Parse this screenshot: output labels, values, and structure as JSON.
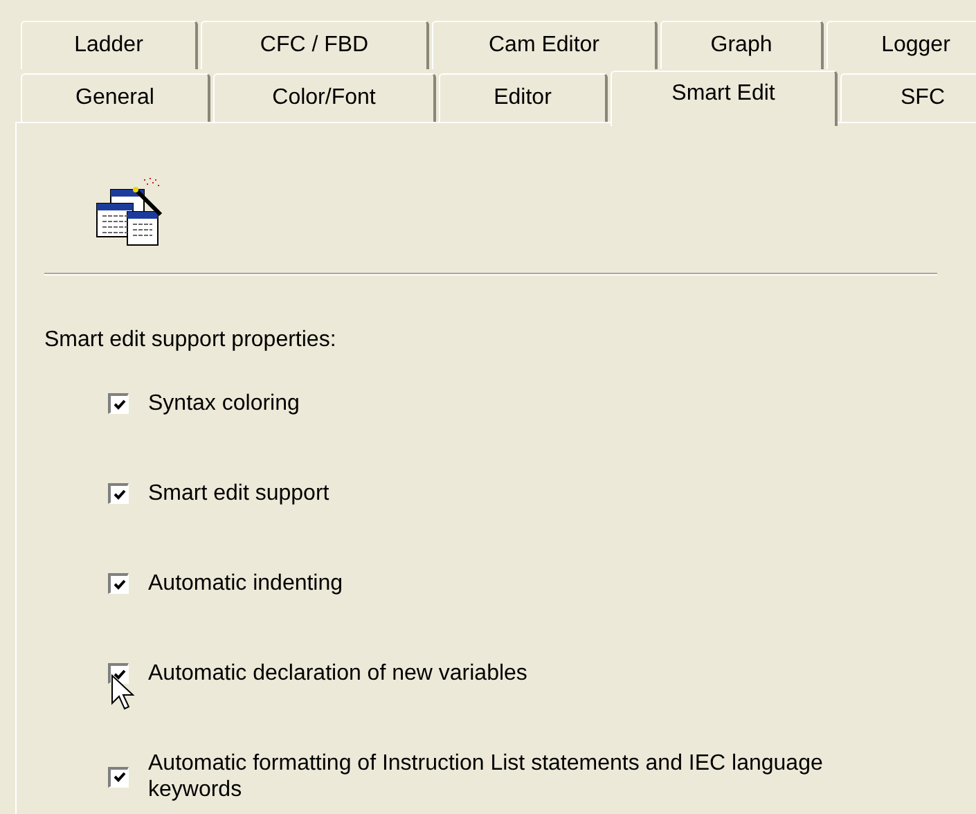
{
  "tab_rows": [
    {
      "tabs": [
        {
          "label": "Ladder",
          "selected": false
        },
        {
          "label": "CFC / FBD",
          "selected": false
        },
        {
          "label": "Cam Editor",
          "selected": false
        },
        {
          "label": "Graph",
          "selected": false
        },
        {
          "label": "Logger",
          "selected": false
        }
      ]
    },
    {
      "tabs": [
        {
          "label": "General",
          "selected": false
        },
        {
          "label": "Color/Font",
          "selected": false
        },
        {
          "label": "Editor",
          "selected": false
        },
        {
          "label": "Smart Edit",
          "selected": true
        },
        {
          "label": "SFC",
          "selected": false
        }
      ]
    }
  ],
  "section_label": "Smart edit support properties:",
  "options": [
    {
      "label": "Syntax coloring",
      "checked": true
    },
    {
      "label": "Smart edit support",
      "checked": true
    },
    {
      "label": "Automatic indenting",
      "checked": true
    },
    {
      "label": "Automatic declaration of new variables",
      "checked": true
    },
    {
      "label": "Automatic formatting of Instruction List statements and IEC language keywords",
      "checked": true
    }
  ]
}
